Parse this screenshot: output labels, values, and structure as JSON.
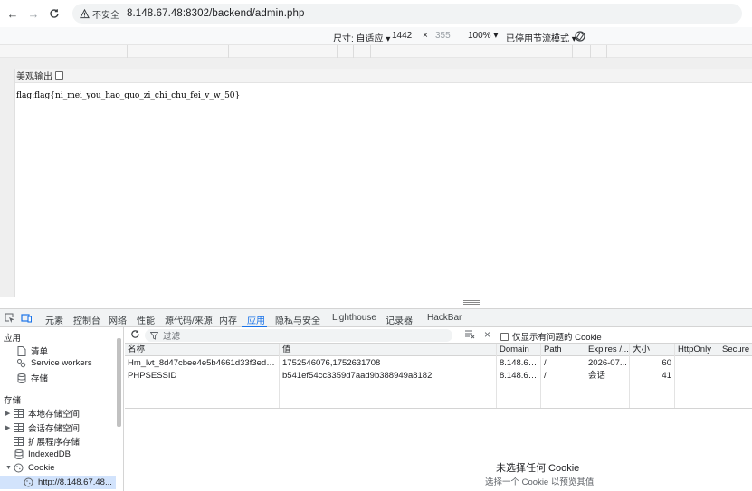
{
  "browser": {
    "security_label": "不安全",
    "url": "8.148.67.48:8302/backend/admin.php"
  },
  "device_toolbar": {
    "dimensions_label": "尺寸: 自适应",
    "width": "1442",
    "times": "×",
    "height": "355",
    "zoom": "100%",
    "throttle": "已停用节流模式"
  },
  "page": {
    "pretty_print_label": "美观输出",
    "flag_text": "flag:flag{ni_mei_you_hao_guo_zi_chi_chu_fei_v_w_50}"
  },
  "devtools": {
    "tabs": [
      "元素",
      "控制台",
      "网络",
      "性能",
      "源代码/来源",
      "内存",
      "应用",
      "隐私与安全",
      "Lighthouse",
      "记录器",
      "HackBar"
    ],
    "active_tab": "应用"
  },
  "sidebar": {
    "app_header": "应用",
    "app_items": [
      "清单",
      "Service workers",
      "存储"
    ],
    "storage_header": "存储",
    "storage_items": [
      "本地存储空间",
      "会话存储空间",
      "扩展程序存储",
      "IndexedDB",
      "Cookie"
    ],
    "cookie_child": "http://8.148.67.48..."
  },
  "cookies": {
    "filter_placeholder": "过滤",
    "only_problem_label": "仅显示有问题的 Cookie",
    "columns": [
      "名称",
      "值",
      "Domain",
      "Path",
      "Expires /...",
      "大小",
      "HttpOnly",
      "Secure"
    ],
    "rows": [
      [
        "Hm_lvt_8d47cbee4e5b4661d33f3edc6...",
        "1752546076,1752631708",
        "8.148.67....",
        "/",
        "2026-07...",
        "60",
        "",
        ""
      ],
      [
        "PHPSESSID",
        "b541ef54cc3359d7aad9b388949a8182",
        "8.148.67....",
        "/",
        "会话",
        "41",
        "",
        ""
      ]
    ],
    "empty_title": "未选择任何 Cookie",
    "empty_subtitle": "选择一个 Cookie 以预览其值"
  },
  "colors": {
    "accent": "#1a73e8",
    "selected_bg": "#d2e3fc"
  }
}
